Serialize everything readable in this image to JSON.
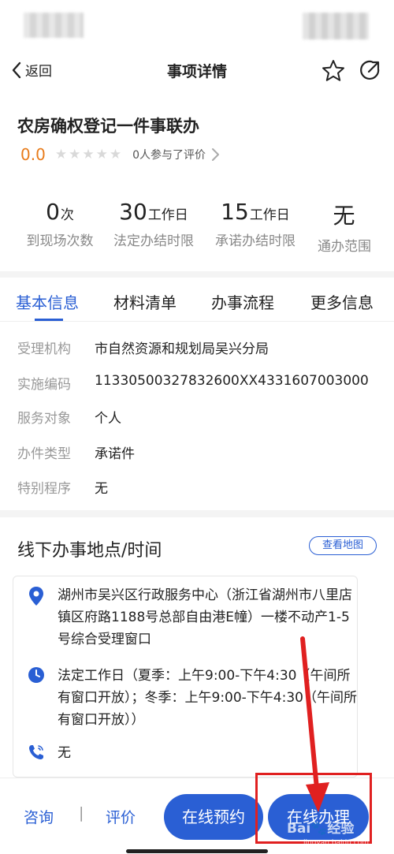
{
  "nav": {
    "back_label": "返回",
    "title": "事项详情"
  },
  "header": {
    "item_name": "农房确权登记一件事联办",
    "score": "0.0",
    "stars": [
      "★",
      "★",
      "★",
      "★",
      "★"
    ],
    "eval_text": "0人参与了评价"
  },
  "stats": [
    {
      "value": "0",
      "unit": "次",
      "label": "到现场次数"
    },
    {
      "value": "30",
      "unit": "工作日",
      "label": "法定办结时限"
    },
    {
      "value": "15",
      "unit": "工作日",
      "label": "承诺办结时限"
    },
    {
      "value": "无",
      "unit": "",
      "label": "通办范围"
    }
  ],
  "tabs": [
    {
      "label": "基本信息",
      "active": true
    },
    {
      "label": "材料清单",
      "active": false
    },
    {
      "label": "办事流程",
      "active": false
    },
    {
      "label": "更多信息",
      "active": false
    }
  ],
  "basic_info": [
    {
      "key": "受理机构",
      "value": "市自然资源和规划局吴兴分局"
    },
    {
      "key": "实施编码",
      "value": "11330500327832600XX4331607003000"
    },
    {
      "key": "服务对象",
      "value": "个人"
    },
    {
      "key": "办件类型",
      "value": "承诺件"
    },
    {
      "key": "特别程序",
      "value": "无"
    }
  ],
  "offline": {
    "title": "线下办事地点/时间",
    "map_button": "查看地图",
    "address": "湖州市吴兴区行政服务中心（浙江省湖州市八里店镇区府路1188号总部自由港E幢）一楼不动产1-5号综合受理窗口",
    "hours": "法定工作日（夏季：上午9:00-下午4:30（午间所有窗口开放）；冬季：上午9:00-下午4:30（午间所有窗口开放））",
    "phone": "无"
  },
  "bottom": {
    "consult_label": "咨询",
    "separator": "|",
    "review_label": "评价",
    "book_online": "在线预约",
    "handle_online": "在线办理"
  },
  "watermark": {
    "text": "Bai🐾经验",
    "sub": "jingyan.baidu.com"
  },
  "colors": {
    "accent": "#2a5fd4",
    "score": "#e87b1a",
    "annotation": "#e02020"
  }
}
